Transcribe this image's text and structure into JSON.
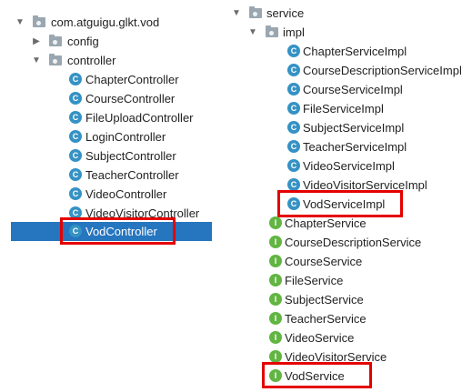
{
  "left_tree": {
    "root": "com.atguigu.glkt.vod",
    "config": "config",
    "controller": "controller",
    "items": [
      "ChapterController",
      "CourseController",
      "FileUploadController",
      "LoginController",
      "SubjectController",
      "TeacherController",
      "VideoController",
      "VideoVisitorController",
      "VodController"
    ]
  },
  "right_tree": {
    "service": "service",
    "impl": "impl",
    "impl_items": [
      "ChapterServiceImpl",
      "CourseDescriptionServiceImpl",
      "CourseServiceImpl",
      "FileServiceImpl",
      "SubjectServiceImpl",
      "TeacherServiceImpl",
      "VideoServiceImpl",
      "VideoVisitorServiceImpl",
      "VodServiceImpl"
    ],
    "interfaces": [
      "ChapterService",
      "CourseDescriptionService",
      "CourseService",
      "FileService",
      "SubjectService",
      "TeacherService",
      "VideoService",
      "VideoVisitorService",
      "VodService"
    ]
  },
  "icons": {
    "class_letter": "C",
    "interface_letter": "I"
  },
  "colors": {
    "selection": "#2675bf",
    "highlight_box": "#e50000",
    "class_icon": "#3592c4",
    "interface_icon": "#62b543",
    "folder": "#9aa7b0"
  }
}
